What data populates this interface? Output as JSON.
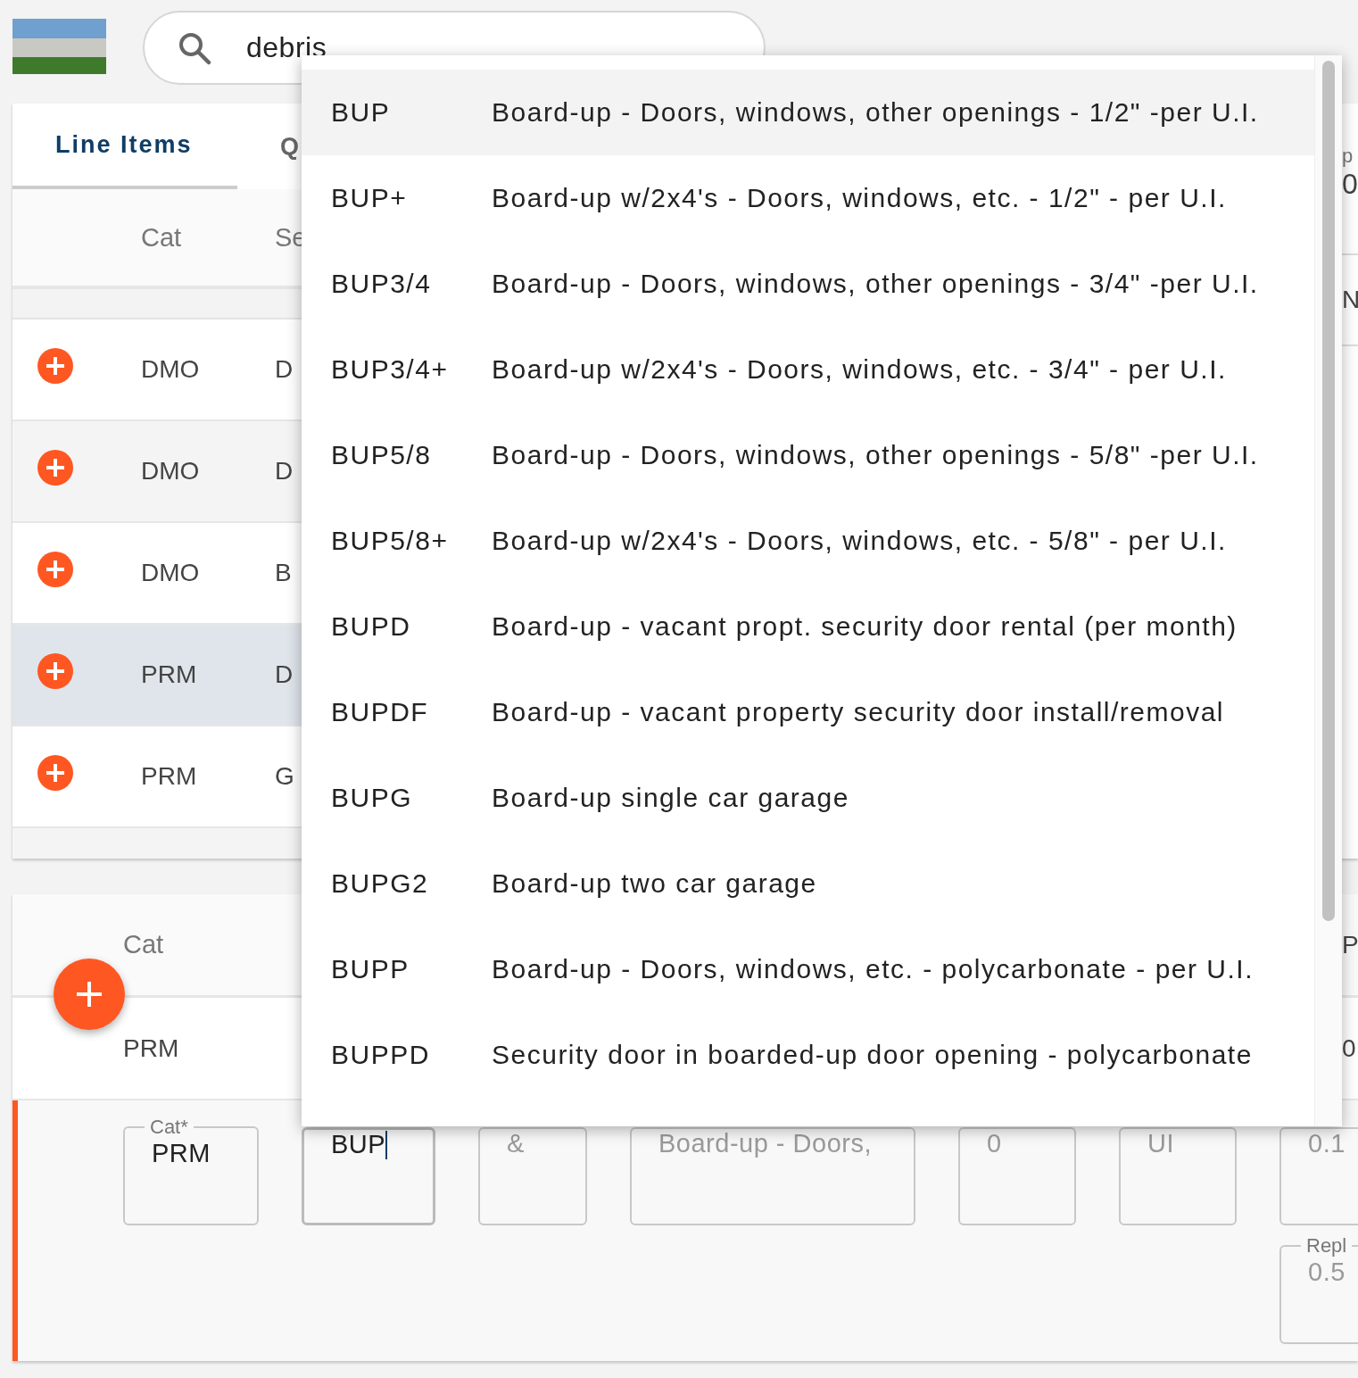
{
  "search": {
    "value": "debris"
  },
  "tabs": [
    {
      "label": "Line Items",
      "selected": true
    },
    {
      "label": "Q",
      "selected": false
    }
  ],
  "table": {
    "columns": [
      "Cat",
      "Se"
    ],
    "rows": [
      {
        "cat": "DMO",
        "sel": "D",
        "selected": false
      },
      {
        "cat": "DMO",
        "sel": "D",
        "selected": false
      },
      {
        "cat": "DMO",
        "sel": "B",
        "selected": false
      },
      {
        "cat": "PRM",
        "sel": "D",
        "selected": true
      },
      {
        "cat": "PRM",
        "sel": "G",
        "selected": false
      }
    ],
    "edge_texts": [
      "p",
      "0",
      "N"
    ]
  },
  "summary_table": {
    "columns": [
      "Cat"
    ],
    "rows": [
      [
        "PRM"
      ]
    ],
    "edge_texts": [
      "P",
      "0"
    ]
  },
  "edit_form": {
    "fields": [
      {
        "label": "Cat*",
        "value": "PRM",
        "focused": false,
        "disabled": false
      },
      {
        "value": "BUP",
        "focused": true,
        "disabled": false
      },
      {
        "value": "&",
        "focused": false,
        "disabled": true
      },
      {
        "value": "Board-up - Doors,",
        "focused": false,
        "disabled": true
      },
      {
        "value": "0",
        "focused": false,
        "disabled": true
      },
      {
        "value": "UI",
        "focused": false,
        "disabled": true
      },
      {
        "value": "0.1",
        "focused": false,
        "disabled": true
      }
    ],
    "extra_field": {
      "label": "Repl",
      "value": "0.5"
    }
  },
  "dropdown": {
    "items": [
      {
        "code": "BUP",
        "description": "Board-up - Doors, windows, other openings - 1/2\" -per U.I.",
        "selected": true
      },
      {
        "code": "BUP+",
        "description": "Board-up w/2x4's - Doors, windows, etc. - 1/2\" - per U.I.",
        "selected": false
      },
      {
        "code": "BUP3/4",
        "description": "Board-up - Doors, windows, other openings - 3/4\" -per U.I.",
        "selected": false
      },
      {
        "code": "BUP3/4+",
        "description": "Board-up w/2x4's - Doors, windows, etc. - 3/4\" - per U.I.",
        "selected": false
      },
      {
        "code": "BUP5/8",
        "description": "Board-up - Doors, windows, other openings - 5/8\" -per U.I.",
        "selected": false
      },
      {
        "code": "BUP5/8+",
        "description": "Board-up w/2x4's - Doors, windows, etc. - 5/8\" - per U.I.",
        "selected": false
      },
      {
        "code": "BUPD",
        "description": "Board-up - vacant propt. security door rental (per month)",
        "selected": false
      },
      {
        "code": "BUPDF",
        "description": "Board-up - vacant property security door install/removal",
        "selected": false
      },
      {
        "code": "BUPG",
        "description": "Board-up single car garage",
        "selected": false
      },
      {
        "code": "BUPG2",
        "description": "Board-up two car garage",
        "selected": false
      },
      {
        "code": "BUPP",
        "description": "Board-up - Doors, windows, etc. - polycarbonate - per U.I.",
        "selected": false
      },
      {
        "code": "BUPPD",
        "description": "Security door in boarded-up door opening - polycarbonate",
        "selected": false
      }
    ]
  }
}
